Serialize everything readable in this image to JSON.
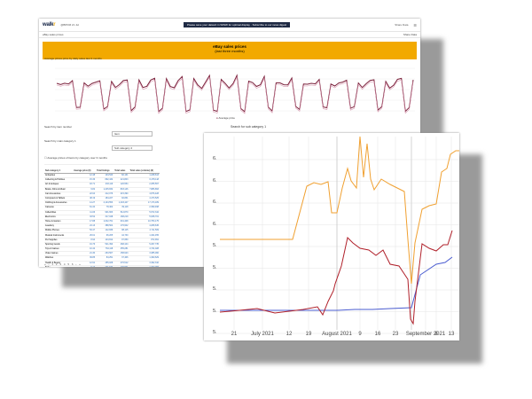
{
  "app": {
    "logo_main": "walk",
    "logo_accent": "r",
    "top_small_left": "eBay sales prices",
    "top_small_mid": "@BPDM 21 Jul",
    "notice": "Please save your dataviz in WWW for optimal display",
    "notice_link": "Subscribe to our news digest",
    "top_right": "Share Data"
  },
  "banner": {
    "title": "eBay sales prices",
    "subtitle": "(last three months)"
  },
  "chart1": {
    "caption": "Average prices price by daily sales last 3 months",
    "legend": "Average price"
  },
  "filters": {
    "label1": "Search by item number",
    "value1": "Item",
    "label2": "Search by main category 1",
    "value2": "Sub category 2"
  },
  "table": {
    "caption": "Average prices of items by category over 3 months",
    "headers": [
      "Sub category 1",
      "Average price (€)",
      "Total listings",
      "Total sales",
      "Total sales (volume) (€)"
    ],
    "rows": [
      [
        "Antiquities",
        "12.48",
        "104,543",
        "82,131",
        "1,248,613"
      ],
      [
        "Collecting & Hobbies",
        "15.36",
        "892,432",
        "421,803",
        "6,478,118"
      ],
      [
        "Art & Antiques",
        "18.71",
        "233,119",
        "120,554",
        "2,255,567"
      ],
      [
        "Books, Films & Music",
        "9.82",
        "1,245,832",
        "803,146",
        "7,886,893"
      ],
      [
        "Car Accessories",
        "22.64",
        "412,076",
        "215,390",
        "4,876,428"
      ],
      [
        "Computers & Tablets",
        "48.19",
        "184,227",
        "92,831",
        "4,473,525"
      ],
      [
        "Clothing & Accessories",
        "14.27",
        "2,104,553",
        "1,203,447",
        "17,173,189"
      ],
      [
        "Cameras",
        "61.34",
        "78,402",
        "39,118",
        "2,399,498"
      ],
      [
        "Collectibles",
        "11.06",
        "901,663",
        "512,870",
        "5,672,342"
      ],
      [
        "Electronics",
        "33.52",
        "317,048",
        "168,219",
        "5,638,701"
      ],
      [
        "Home & Garden",
        "17.88",
        "1,032,761",
        "601,408",
        "10,753,175"
      ],
      [
        "Jewellery",
        "24.13",
        "388,504",
        "176,902",
        "4,268,645"
      ],
      [
        "Mobile Phones",
        "53.47",
        "142,836",
        "88,115",
        "4,711,509"
      ],
      [
        "Musical Instruments",
        "29.61",
        "96,205",
        "44,730",
        "1,324,455"
      ],
      [
        "Pet Supplies",
        "8.94",
        "143,812",
        "97,650",
        "872,991"
      ],
      [
        "Sporting Goods",
        "19.76",
        "521,390",
        "268,104",
        "5,297,735"
      ],
      [
        "Toys & Games",
        "10.42",
        "764,118",
        "455,281",
        "4,744,028"
      ],
      [
        "Video Games",
        "21.30",
        "263,507",
        "158,923",
        "3,385,060"
      ],
      [
        "Watches",
        "39.85",
        "84,251",
        "37,406",
        "1,490,629"
      ],
      [
        "Health & Beauty",
        "12.91",
        "455,028",
        "270,512",
        "3,492,310"
      ],
      [
        "Baby",
        "9.17",
        "201,634",
        "130,871",
        "1,200,087"
      ],
      [
        "Tickets & Travel",
        "44.26",
        "31,508",
        "15,237",
        "674,390"
      ],
      [
        "Wholesale & Job Lots",
        "16.53",
        "58,906",
        "22,714",
        "375,462"
      ],
      [
        "Everything Else",
        "7.68",
        "312,449",
        "145,096",
        "1,114,337"
      ],
      [
        "Business & Industrial",
        "36.09",
        "72,885",
        "29,843",
        "1,077,034"
      ]
    ],
    "pager": "« ‹ 1 2 3 4 5 6 › »"
  },
  "chart2": {
    "caption": "Search for sub category 1",
    "x_ticks": [
      "21",
      "July 2021",
      "12",
      "19",
      "August 2021",
      "9",
      "16",
      "23",
      "September 2021",
      "6",
      "13"
    ],
    "y_ticks": [
      "6.",
      "6.",
      "6.",
      "6.",
      "5.",
      "5.",
      "5.",
      "5.",
      "5."
    ]
  },
  "colors": {
    "banner": "#f2a900",
    "series_orange": "#f0a030",
    "series_red": "#b0202a",
    "series_blue": "#4a5cd0",
    "series_maroon": "#7a1f3a"
  }
}
